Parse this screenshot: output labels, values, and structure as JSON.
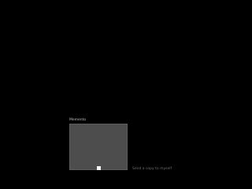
{
  "panel": {
    "label": "Memento"
  },
  "status": {
    "text": "Send a copy to myself"
  },
  "colors": {
    "background": "#000000",
    "box": "#4d4d4d",
    "handle": "#f2f2f2",
    "label": "#bdbdbd",
    "status": "#6e6e6e"
  }
}
